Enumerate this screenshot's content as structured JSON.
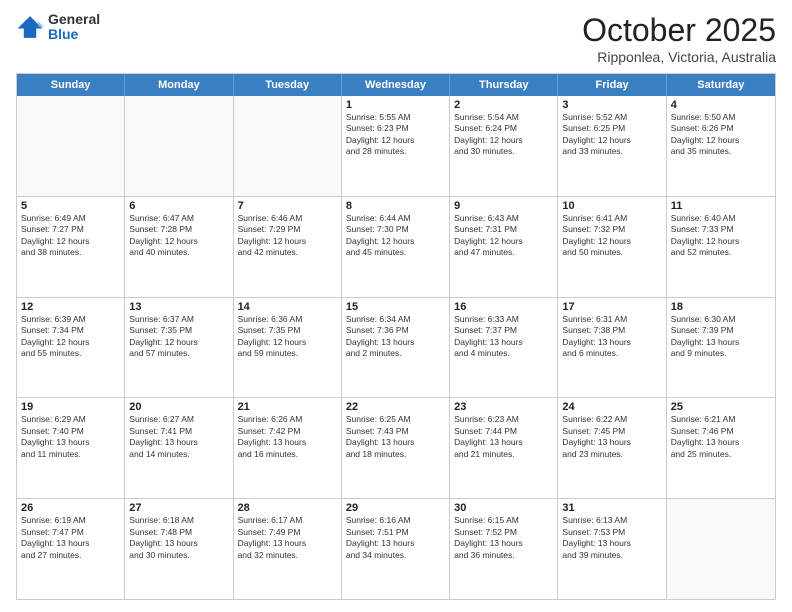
{
  "header": {
    "logo_general": "General",
    "logo_blue": "Blue",
    "month": "October 2025",
    "location": "Ripponlea, Victoria, Australia"
  },
  "weekdays": [
    "Sunday",
    "Monday",
    "Tuesday",
    "Wednesday",
    "Thursday",
    "Friday",
    "Saturday"
  ],
  "rows": [
    [
      {
        "day": "",
        "info": ""
      },
      {
        "day": "",
        "info": ""
      },
      {
        "day": "",
        "info": ""
      },
      {
        "day": "1",
        "info": "Sunrise: 5:55 AM\nSunset: 6:23 PM\nDaylight: 12 hours\nand 28 minutes."
      },
      {
        "day": "2",
        "info": "Sunrise: 5:54 AM\nSunset: 6:24 PM\nDaylight: 12 hours\nand 30 minutes."
      },
      {
        "day": "3",
        "info": "Sunrise: 5:52 AM\nSunset: 6:25 PM\nDaylight: 12 hours\nand 33 minutes."
      },
      {
        "day": "4",
        "info": "Sunrise: 5:50 AM\nSunset: 6:26 PM\nDaylight: 12 hours\nand 35 minutes."
      }
    ],
    [
      {
        "day": "5",
        "info": "Sunrise: 6:49 AM\nSunset: 7:27 PM\nDaylight: 12 hours\nand 38 minutes."
      },
      {
        "day": "6",
        "info": "Sunrise: 6:47 AM\nSunset: 7:28 PM\nDaylight: 12 hours\nand 40 minutes."
      },
      {
        "day": "7",
        "info": "Sunrise: 6:46 AM\nSunset: 7:29 PM\nDaylight: 12 hours\nand 42 minutes."
      },
      {
        "day": "8",
        "info": "Sunrise: 6:44 AM\nSunset: 7:30 PM\nDaylight: 12 hours\nand 45 minutes."
      },
      {
        "day": "9",
        "info": "Sunrise: 6:43 AM\nSunset: 7:31 PM\nDaylight: 12 hours\nand 47 minutes."
      },
      {
        "day": "10",
        "info": "Sunrise: 6:41 AM\nSunset: 7:32 PM\nDaylight: 12 hours\nand 50 minutes."
      },
      {
        "day": "11",
        "info": "Sunrise: 6:40 AM\nSunset: 7:33 PM\nDaylight: 12 hours\nand 52 minutes."
      }
    ],
    [
      {
        "day": "12",
        "info": "Sunrise: 6:39 AM\nSunset: 7:34 PM\nDaylight: 12 hours\nand 55 minutes."
      },
      {
        "day": "13",
        "info": "Sunrise: 6:37 AM\nSunset: 7:35 PM\nDaylight: 12 hours\nand 57 minutes."
      },
      {
        "day": "14",
        "info": "Sunrise: 6:36 AM\nSunset: 7:35 PM\nDaylight: 12 hours\nand 59 minutes."
      },
      {
        "day": "15",
        "info": "Sunrise: 6:34 AM\nSunset: 7:36 PM\nDaylight: 13 hours\nand 2 minutes."
      },
      {
        "day": "16",
        "info": "Sunrise: 6:33 AM\nSunset: 7:37 PM\nDaylight: 13 hours\nand 4 minutes."
      },
      {
        "day": "17",
        "info": "Sunrise: 6:31 AM\nSunset: 7:38 PM\nDaylight: 13 hours\nand 6 minutes."
      },
      {
        "day": "18",
        "info": "Sunrise: 6:30 AM\nSunset: 7:39 PM\nDaylight: 13 hours\nand 9 minutes."
      }
    ],
    [
      {
        "day": "19",
        "info": "Sunrise: 6:29 AM\nSunset: 7:40 PM\nDaylight: 13 hours\nand 11 minutes."
      },
      {
        "day": "20",
        "info": "Sunrise: 6:27 AM\nSunset: 7:41 PM\nDaylight: 13 hours\nand 14 minutes."
      },
      {
        "day": "21",
        "info": "Sunrise: 6:26 AM\nSunset: 7:42 PM\nDaylight: 13 hours\nand 16 minutes."
      },
      {
        "day": "22",
        "info": "Sunrise: 6:25 AM\nSunset: 7:43 PM\nDaylight: 13 hours\nand 18 minutes."
      },
      {
        "day": "23",
        "info": "Sunrise: 6:23 AM\nSunset: 7:44 PM\nDaylight: 13 hours\nand 21 minutes."
      },
      {
        "day": "24",
        "info": "Sunrise: 6:22 AM\nSunset: 7:45 PM\nDaylight: 13 hours\nand 23 minutes."
      },
      {
        "day": "25",
        "info": "Sunrise: 6:21 AM\nSunset: 7:46 PM\nDaylight: 13 hours\nand 25 minutes."
      }
    ],
    [
      {
        "day": "26",
        "info": "Sunrise: 6:19 AM\nSunset: 7:47 PM\nDaylight: 13 hours\nand 27 minutes."
      },
      {
        "day": "27",
        "info": "Sunrise: 6:18 AM\nSunset: 7:48 PM\nDaylight: 13 hours\nand 30 minutes."
      },
      {
        "day": "28",
        "info": "Sunrise: 6:17 AM\nSunset: 7:49 PM\nDaylight: 13 hours\nand 32 minutes."
      },
      {
        "day": "29",
        "info": "Sunrise: 6:16 AM\nSunset: 7:51 PM\nDaylight: 13 hours\nand 34 minutes."
      },
      {
        "day": "30",
        "info": "Sunrise: 6:15 AM\nSunset: 7:52 PM\nDaylight: 13 hours\nand 36 minutes."
      },
      {
        "day": "31",
        "info": "Sunrise: 6:13 AM\nSunset: 7:53 PM\nDaylight: 13 hours\nand 39 minutes."
      },
      {
        "day": "",
        "info": ""
      }
    ]
  ]
}
